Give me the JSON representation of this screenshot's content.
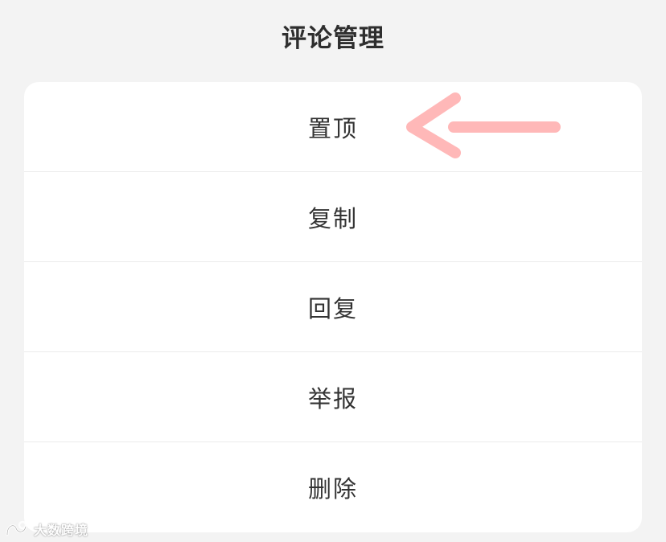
{
  "sheet": {
    "title": "评论管理",
    "items": [
      {
        "label": "置顶"
      },
      {
        "label": "复制"
      },
      {
        "label": "回复"
      },
      {
        "label": "举报"
      },
      {
        "label": "删除"
      }
    ]
  },
  "annotation": {
    "icon": "left-arrow-icon",
    "color": "#ffb3b3"
  },
  "watermark": {
    "text": "大数跨境",
    "icon": "brand-logo-icon"
  }
}
